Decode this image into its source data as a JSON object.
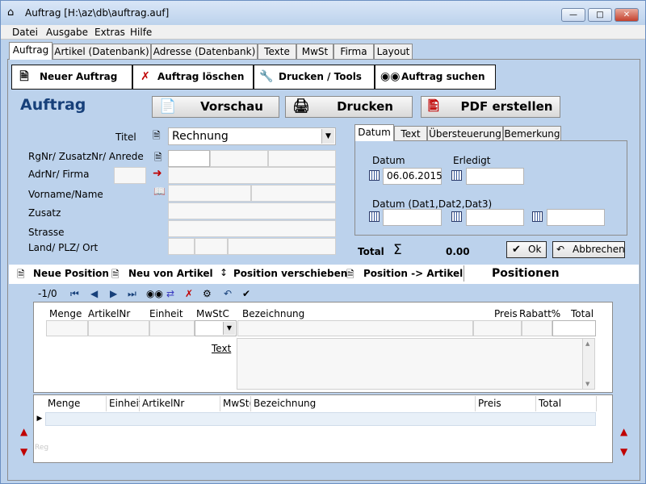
{
  "window": {
    "title": "Auftrag [H:\\az\\db\\auftrag.auf]"
  },
  "menu": [
    "Datei",
    "Ausgabe",
    "Extras",
    "Hilfe"
  ],
  "tabs": [
    "Auftrag",
    "Artikel (Datenbank)",
    "Adresse (Datenbank)",
    "Texte",
    "MwSt",
    "Firma",
    "Layout"
  ],
  "toolbar": {
    "neuer_auftrag": "Neuer Auftrag",
    "auftrag_loeschen": "Auftrag löschen",
    "drucken_tools": "Drucken / Tools",
    "auftrag_suchen": "Auftrag suchen"
  },
  "section_title": "Auftrag",
  "actions": {
    "vorschau": "Vorschau",
    "drucken": "Drucken",
    "pdf": "PDF erstellen"
  },
  "form": {
    "titel_label": "Titel",
    "titel_value": "Rechnung",
    "rgnr_label": "RgNr/ ZusatzNr/ Anrede",
    "adrnr_label": "AdrNr/ Firma",
    "vorname_label": "Vorname/Name",
    "zusatz_label": "Zusatz",
    "strasse_label": "Strasse",
    "land_label": "Land/ PLZ/ Ort"
  },
  "right_tabs": [
    "Datum",
    "Text",
    "Übersteuerung",
    "Bemerkung"
  ],
  "dates": {
    "datum_label": "Datum",
    "datum_value": "06.06.2015",
    "erledigt_label": "Erledigt",
    "dat_label": "Datum (Dat1,Dat2,Dat3)"
  },
  "totals": {
    "label": "Total",
    "sigma": "Σ",
    "value": "0.00",
    "ok": "Ok",
    "abbrechen": "Abbrechen"
  },
  "positions_bar": {
    "neue_position": "Neue Position",
    "neu_von_artikel": "Neu von Artikel",
    "position_verschieben": "Position verschieben",
    "position_artikel": "Position -> Artikel",
    "title": "Positionen"
  },
  "nav": {
    "counter": "-1/0"
  },
  "grid1": {
    "headers": [
      "Menge",
      "ArtikelNr",
      "Einheit",
      "MwStC",
      "Bezeichnung",
      "Preis",
      "Rabatt%",
      "Total"
    ],
    "text_label": "Text"
  },
  "grid2": {
    "headers": [
      "Menge",
      "Einheit",
      "ArtikelNr",
      "MwSt(",
      "Bezeichnung",
      "Preis",
      "Total"
    ],
    "watermark": "Reg"
  },
  "colors": {
    "window_bg": "#bcd2ec",
    "title_blue": "#17407a",
    "arrow_red": "#c00000"
  }
}
